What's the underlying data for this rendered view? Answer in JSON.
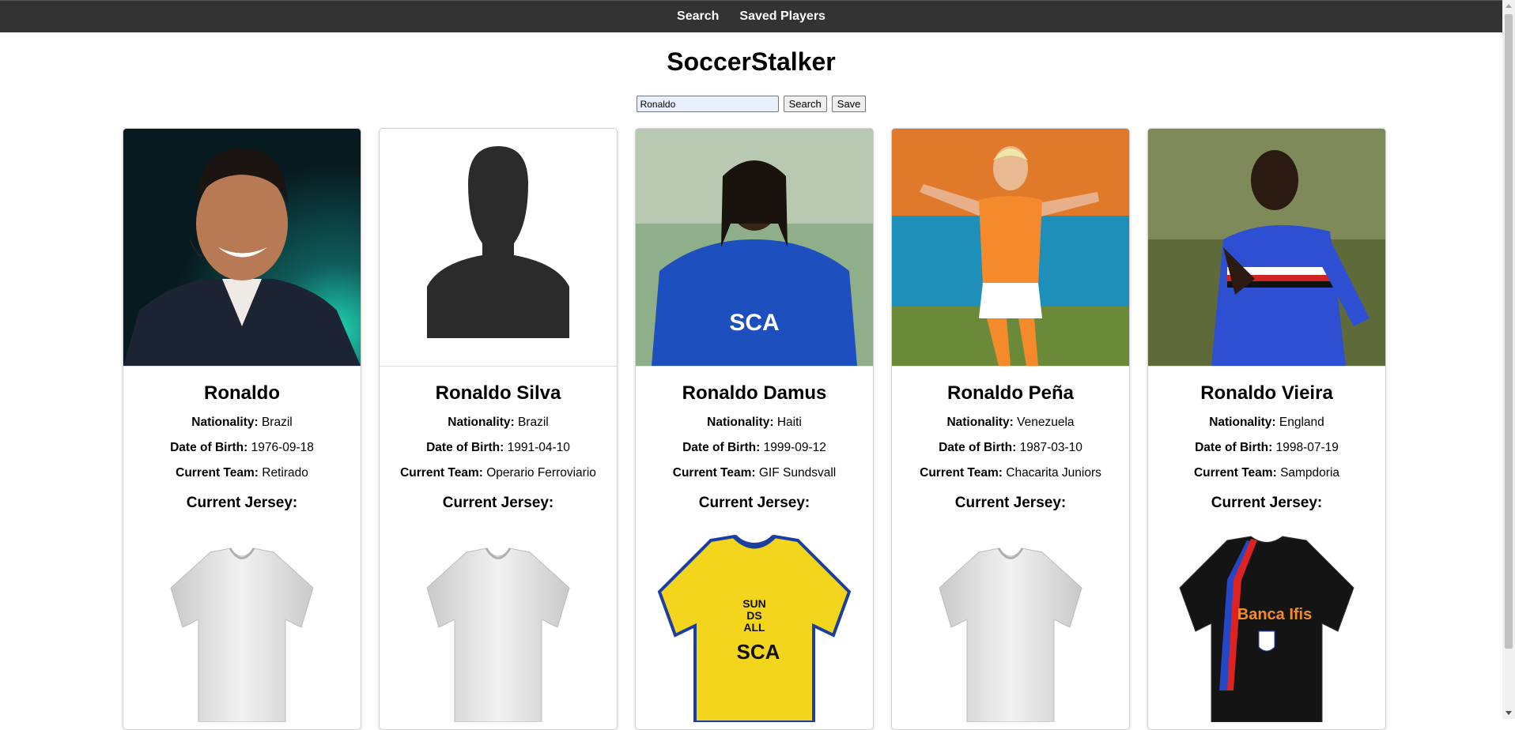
{
  "nav": {
    "search": "Search",
    "saved": "Saved Players"
  },
  "app": {
    "title": "SoccerStalker"
  },
  "search": {
    "value": "Ronaldo",
    "search_button": "Search",
    "save_button": "Save"
  },
  "labels": {
    "nationality": "Nationality:",
    "dob": "Date of Birth:",
    "team": "Current Team:",
    "jersey": "Current Jersey:"
  },
  "players": [
    {
      "name": "Ronaldo",
      "nationality": "Brazil",
      "dob": "1976-09-18",
      "team": "Retirado"
    },
    {
      "name": "Ronaldo Silva",
      "nationality": "Brazil",
      "dob": "1991-04-10",
      "team": "Operario Ferroviario"
    },
    {
      "name": "Ronaldo Damus",
      "nationality": "Haiti",
      "dob": "1999-09-12",
      "team": "GIF Sundsvall"
    },
    {
      "name": "Ronaldo Peña",
      "nationality": "Venezuela",
      "dob": "1987-03-10",
      "team": "Chacarita Juniors"
    },
    {
      "name": "Ronaldo Vieira",
      "nationality": "England",
      "dob": "1998-07-19",
      "team": "Sampdoria"
    }
  ],
  "jersey_text": {
    "sca": "SCA",
    "sun": "SUN",
    "ds": "DS",
    "all": "ALL",
    "bancaifis": "Banca Ifis"
  },
  "colors": {
    "nav_bg": "#333333",
    "page_bg": "#ffffff"
  }
}
